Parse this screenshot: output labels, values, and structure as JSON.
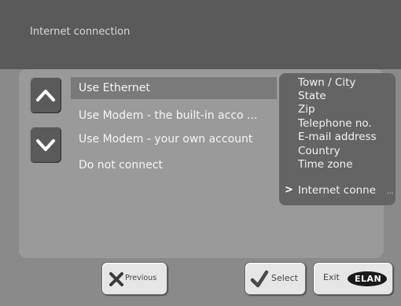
{
  "header": {
    "title": "Internet connection"
  },
  "options": [
    {
      "label": "Use Ethernet"
    },
    {
      "label": "Use Modem - the built-in acco ..."
    },
    {
      "label": "Use Modem - your own account"
    },
    {
      "label": "Do not connect"
    }
  ],
  "steps": [
    {
      "label": "Town / City"
    },
    {
      "label": "State"
    },
    {
      "label": "Zip"
    },
    {
      "label": "Telephone no."
    },
    {
      "label": "E-mail address"
    },
    {
      "label": "Country"
    },
    {
      "label": "Time zone"
    },
    {
      "label": "Internet conne"
    }
  ],
  "current_step_marker": ">",
  "current_step_overflow": "...",
  "selected_option_index": 0,
  "buttons": {
    "previous_label": "Previous",
    "select_label": "Select",
    "exit_label": "Exit",
    "logo_text": "ELAN"
  },
  "icons": {
    "up": "chevron-up-icon",
    "down": "chevron-down-icon",
    "previous": "x-icon",
    "select": "checkmark-icon"
  },
  "colors": {
    "header_bg": "#5a5a5a",
    "panel_bg": "#9a9a9a",
    "steps_bg": "#646464",
    "selection_bg": "#7a7a7a",
    "button_bg": "#e6e6e6",
    "select_check": "#4a4a4a"
  }
}
